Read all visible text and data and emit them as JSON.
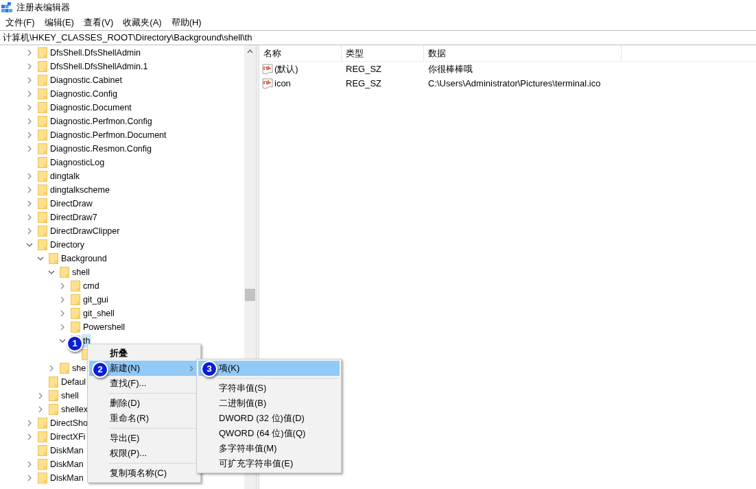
{
  "window": {
    "title": "注册表编辑器"
  },
  "menu_bar": [
    "文件(F)",
    "编辑(E)",
    "查看(V)",
    "收藏夹(A)",
    "帮助(H)"
  ],
  "address": "计算机\\HKEY_CLASSES_ROOT\\Directory\\Background\\shell\\th",
  "tree": [
    {
      "label": "DfsShell.DfsShellAdmin",
      "expanded": false,
      "selected": false
    },
    {
      "label": "DfsShell.DfsShellAdmin.1",
      "expanded": false,
      "selected": false
    },
    {
      "label": "Diagnostic.Cabinet",
      "expanded": false,
      "selected": false
    },
    {
      "label": "Diagnostic.Config",
      "expanded": false,
      "selected": false
    },
    {
      "label": "Diagnostic.Document",
      "expanded": false,
      "selected": false
    },
    {
      "label": "Diagnostic.Perfmon.Config",
      "expanded": false,
      "selected": false
    },
    {
      "label": "Diagnostic.Perfmon.Document",
      "expanded": false,
      "selected": false
    },
    {
      "label": "Diagnostic.Resmon.Config",
      "expanded": false,
      "selected": false
    },
    {
      "label": "DiagnosticLog",
      "selected": false
    },
    {
      "label": "dingtalk",
      "expanded": false,
      "selected": false
    },
    {
      "label": "dingtalkscheme",
      "expanded": false,
      "selected": false
    },
    {
      "label": "DirectDraw",
      "expanded": false,
      "selected": false
    },
    {
      "label": "DirectDraw7",
      "expanded": false,
      "selected": false
    },
    {
      "label": "DirectDrawClipper",
      "expanded": false,
      "selected": false
    },
    {
      "label": "Directory",
      "expanded": true,
      "selected": false,
      "children": [
        {
          "label": "Background",
          "expanded": true,
          "selected": false,
          "children": [
            {
              "label": "shell",
              "expanded": true,
              "selected": false,
              "children": [
                {
                  "label": "cmd",
                  "expanded": false,
                  "selected": false
                },
                {
                  "label": "git_gui",
                  "expanded": false,
                  "selected": false
                },
                {
                  "label": "git_shell",
                  "expanded": false,
                  "selected": false
                },
                {
                  "label": "Powershell",
                  "expanded": false,
                  "selected": false
                },
                {
                  "label": "th",
                  "expanded": true,
                  "selected": true,
                  "children": [
                    {
                      "selected": false
                    }
                  ]
                }
              ]
            },
            {
              "label": "she",
              "expanded": false,
              "selected": false
            }
          ]
        },
        {
          "label": "Defaul",
          "selected": false
        },
        {
          "label": "shell",
          "expanded": false,
          "selected": false
        },
        {
          "label": "shellex",
          "expanded": false,
          "selected": false
        }
      ]
    },
    {
      "label": "DirectSho",
      "expanded": false,
      "selected": false
    },
    {
      "label": "DirectXFi",
      "expanded": false,
      "selected": false
    },
    {
      "label": "DiskMan",
      "selected": false
    },
    {
      "label": "DiskMan",
      "expanded": false,
      "selected": false
    },
    {
      "label": "DiskMan",
      "expanded": false,
      "selected": false
    }
  ],
  "table": {
    "columns": [
      "名称",
      "类型",
      "数据"
    ],
    "rows": [
      {
        "name": "(默认)",
        "type": "REG_SZ",
        "data": "你很棒棒哦"
      },
      {
        "name": "icon",
        "type": "REG_SZ",
        "data": "C:\\Users\\Administrator\\Pictures\\terminal.ico"
      }
    ]
  },
  "context_menu": [
    {
      "kind": "item",
      "label": "折叠",
      "bold": true,
      "selected": false
    },
    {
      "kind": "item",
      "label": "新建(N)",
      "selected": true,
      "submenu": true
    },
    {
      "kind": "item",
      "label": "查找(F)...",
      "selected": false
    },
    {
      "kind": "separator"
    },
    {
      "kind": "item",
      "label": "删除(D)",
      "selected": false
    },
    {
      "kind": "item",
      "label": "重命名(R)",
      "selected": false
    },
    {
      "kind": "separator"
    },
    {
      "kind": "item",
      "label": "导出(E)",
      "selected": false
    },
    {
      "kind": "item",
      "label": "权限(P)...",
      "selected": false
    },
    {
      "kind": "separator"
    },
    {
      "kind": "item",
      "label": "复制项名称(C)",
      "selected": false
    }
  ],
  "submenu": [
    {
      "kind": "item",
      "label": "项(K)",
      "selected": true
    },
    {
      "kind": "separator"
    },
    {
      "kind": "item",
      "label": "字符串值(S)",
      "selected": false
    },
    {
      "kind": "item",
      "label": "二进制值(B)",
      "selected": false
    },
    {
      "kind": "item",
      "label": "DWORD (32 位)值(D)",
      "selected": false
    },
    {
      "kind": "item",
      "label": "QWORD (64 位)值(Q)",
      "selected": false
    },
    {
      "kind": "item",
      "label": "多字符串值(M)",
      "selected": false
    },
    {
      "kind": "item",
      "label": "可扩充字符串值(E)",
      "selected": false
    }
  ],
  "annotations": [
    "1",
    "2",
    "3"
  ]
}
